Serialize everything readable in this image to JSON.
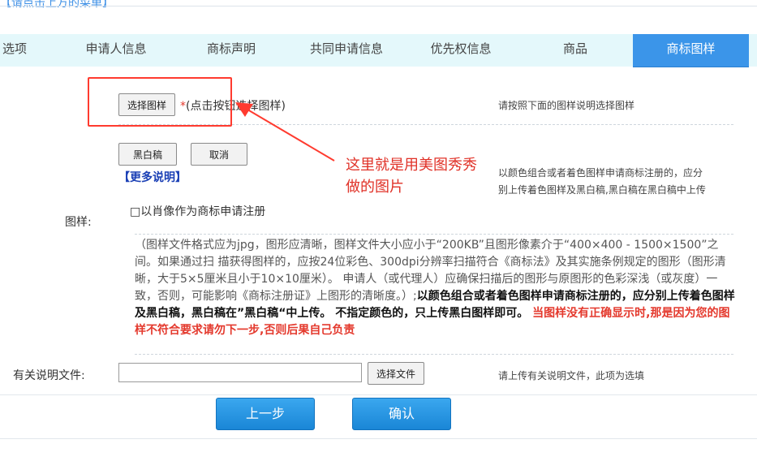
{
  "header": {
    "title": "【请点击上方的菜单】"
  },
  "tabs": [
    {
      "label": "选项",
      "active": false
    },
    {
      "label": "申请人信息",
      "active": false
    },
    {
      "label": "商标声明",
      "active": false
    },
    {
      "label": "共同申请信息",
      "active": false
    },
    {
      "label": "优先权信息",
      "active": false
    },
    {
      "label": "商品",
      "active": false
    },
    {
      "label": "商标图样",
      "active": true
    }
  ],
  "upload": {
    "choose_image_label": "选择图样",
    "required_mark": "*",
    "choose_hint": "(点击按钮选择图样)",
    "right_hint": "请按照下面的图样说明选择图样"
  },
  "image_options": {
    "bw_button": "黑白稿",
    "cancel_button": "取消",
    "more_link": "【更多说明】",
    "right_desc_line1": "以颜色组合或者着色图样申请商标注册的，应分",
    "right_desc_line2": "别上传着色图样及黑白稿,黑白稿在黑白稿中上传",
    "portrait_checkbox_label": "□以肖像作为商标申请注册",
    "field_label": "图样:"
  },
  "note": {
    "plain": "（图样文件格式应为jpg，图形应清晰，图样文件大小应小于“200KB”且图形像素介于“400×400 - 1500×1500”之间。如果通过扫 描获得图样的，应按24位彩色、300dpi分辨率扫描符合《商标法》及其实施条例规定的图形（图形清晰，大于5×5厘米且小于10×10厘米）。 申请人（或代理人）应确保扫描后的图形与原图形的色彩深浅（或灰度）一致，否则，可能影响《商标注册证》上图形的清晰度。）;",
    "bold": "以颜色组合或者着色图样申请商标注册的，应分别上传着色图样及黑白稿，黑白稿在”黑白稿“中上传。 不指定颜色的，只上传黑白图样即可。",
    "red": " 当图样没有正确显示时,那是因为您的图样不符合要求请勿下一步,否则后果自己负责"
  },
  "attachment": {
    "label": "有关说明文件:",
    "input_value": "",
    "choose_file_button": "选择文件",
    "hint": "请上传有关说明文件，此项为选填"
  },
  "footer": {
    "prev_button": "上一步",
    "confirm_button": "确认"
  },
  "annotation": {
    "text_line1": "这里就是用美图秀秀",
    "text_line2": "做的图片"
  },
  "colors": {
    "tab_bg": "#e4f8fb",
    "tab_active": "#3b95e9",
    "annotation_red": "#ff3b2f",
    "primary_button": "#1a86d6"
  }
}
